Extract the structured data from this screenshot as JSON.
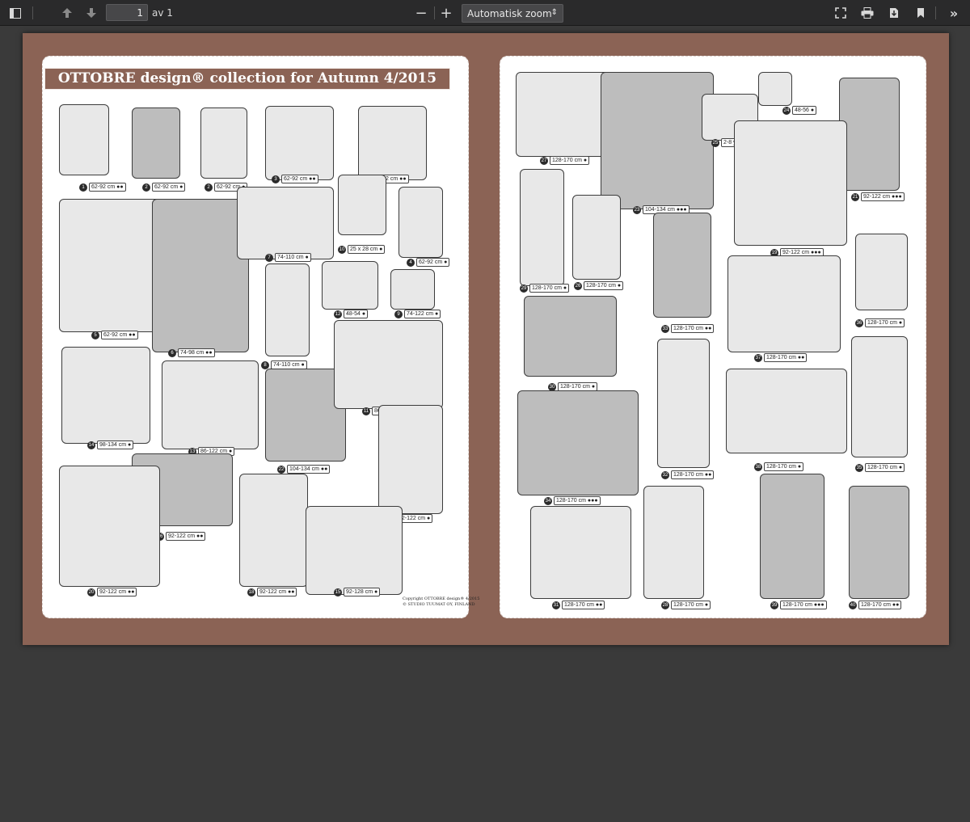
{
  "toolbar": {
    "page_value": "1",
    "page_of": "av 1",
    "zoom_minus": "−",
    "zoom_plus": "+",
    "zoom_label": "Automatisk zoom",
    "icons": [
      "sidebar-toggle-icon",
      "previous-page-icon",
      "next-page-icon",
      "zoom-out-icon",
      "zoom-in-icon",
      "presentation-mode-icon",
      "print-icon",
      "download-icon",
      "bookmark-icon",
      "tools-icon"
    ]
  },
  "document": {
    "title": "OTTOBRE design® collection for Autumn 4/2015",
    "copyright_line1": "Copyright OTTOBRE design® 4/2015",
    "copyright_line2": "© STUDIO TUUMAT OY, FINLAND",
    "left_items": [
      {
        "num": "1",
        "size": "62-92 cm ●●"
      },
      {
        "num": "2",
        "size": "62-92 cm ●"
      },
      {
        "num": "2",
        "size": "62-92 cm ●"
      },
      {
        "num": "3",
        "size": "62-92 cm ●●"
      },
      {
        "num": "3",
        "size": "62-92 cm ●●"
      },
      {
        "num": "5",
        "size": "62-92 cm ●●"
      },
      {
        "num": "6",
        "size": "74-98 cm ●●"
      },
      {
        "num": "7",
        "size": "74-110 cm ●"
      },
      {
        "num": "10",
        "size": "25 x 28 cm ●"
      },
      {
        "num": "4",
        "size": "62-92 cm ●"
      },
      {
        "num": "8",
        "size": "74-110 cm ●"
      },
      {
        "num": "12",
        "size": "48-54 ●"
      },
      {
        "num": "9",
        "size": "74-122 cm ●"
      },
      {
        "num": "14",
        "size": "98-134 cm ●"
      },
      {
        "num": "13",
        "size": "86-122 cm ●"
      },
      {
        "num": "22",
        "size": "104-134 cm ●●"
      },
      {
        "num": "11",
        "size": "86-122 cm ●●"
      },
      {
        "num": "17",
        "size": "92-122 cm ●"
      },
      {
        "num": "16",
        "size": "92-122 cm ●●"
      },
      {
        "num": "20",
        "size": "92-122 cm ●●"
      },
      {
        "num": "18",
        "size": "92-122 cm ●●"
      },
      {
        "num": "15",
        "size": "92-128 cm ●"
      }
    ],
    "right_items": [
      {
        "num": "27",
        "size": "128-170 cm ●"
      },
      {
        "num": "23",
        "size": "104-134 cm ●●●"
      },
      {
        "num": "25",
        "size": "2-8 yrs ●"
      },
      {
        "num": "24",
        "size": "48-56 ●"
      },
      {
        "num": "21",
        "size": "92-122 cm ●●●"
      },
      {
        "num": "19",
        "size": "92-122 cm ●●●"
      },
      {
        "num": "29",
        "size": "128-170 cm ●"
      },
      {
        "num": "26",
        "size": "128-170 cm ●"
      },
      {
        "num": "33",
        "size": "128-170 cm ●●"
      },
      {
        "num": "36",
        "size": "128-170 cm ●"
      },
      {
        "num": "37",
        "size": "128-170 cm ●●"
      },
      {
        "num": "30",
        "size": "128-170 cm ●"
      },
      {
        "num": "32",
        "size": "128-170 cm ●●"
      },
      {
        "num": "38",
        "size": "128-170 cm ●"
      },
      {
        "num": "35",
        "size": "128-170 cm ●"
      },
      {
        "num": "34",
        "size": "128-170 cm ●●●"
      },
      {
        "num": "31",
        "size": "128-170 cm ●●"
      },
      {
        "num": "28",
        "size": "128-170 cm ●"
      },
      {
        "num": "39",
        "size": "128-170 cm ●●●"
      },
      {
        "num": "40",
        "size": "128-170 cm ●●"
      }
    ]
  },
  "colors": {
    "sheet": "#8b6355",
    "toolbar": "#2a2a2b",
    "viewer_bg": "#3a3a3a"
  }
}
